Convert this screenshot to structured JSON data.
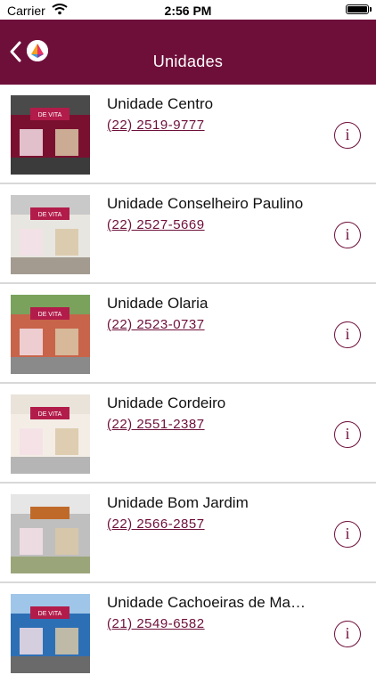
{
  "status": {
    "carrier": "Carrier",
    "time": "2:56 PM"
  },
  "nav": {
    "title": "Unidades",
    "back_icon": "chevron-left-icon",
    "logo": "devita-logo"
  },
  "brand": {
    "primary": "#6e0f3a"
  },
  "units": [
    {
      "name": "Unidade Centro",
      "phone": "(22) 2519-9777",
      "sign": "DE VITA"
    },
    {
      "name": "Unidade Conselheiro Paulino",
      "phone": "(22) 2527-5669",
      "sign": "DE VITA"
    },
    {
      "name": "Unidade Olaria",
      "phone": "(22) 2523-0737",
      "sign": "DE VITA"
    },
    {
      "name": "Unidade Cordeiro",
      "phone": "(22) 2551-2387",
      "sign": "DE VITA"
    },
    {
      "name": "Unidade Bom Jardim",
      "phone": "(22) 2566-2857",
      "sign": ""
    },
    {
      "name": "Unidade Cachoeiras de Ma…",
      "phone": "(21) 2549-6582",
      "sign": "DE VITA"
    }
  ]
}
